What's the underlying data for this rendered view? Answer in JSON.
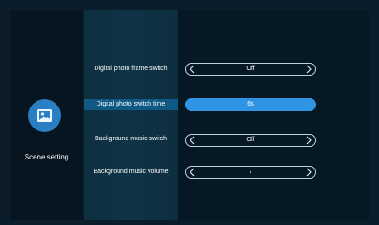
{
  "sidebar": {
    "item_label": "Scene setting",
    "icon": "picture-icon",
    "accent": "#2a7fc4"
  },
  "settings": [
    {
      "label": "Digital photo frame switch",
      "value": "Off",
      "active": false
    },
    {
      "label": "Digital photo switch time",
      "value": "6s",
      "active": true
    },
    {
      "label": "Background music switch",
      "value": "Off",
      "active": false
    },
    {
      "label": "Background music volume",
      "value": "7",
      "active": false
    }
  ],
  "colors": {
    "selected_row": "#0f5985",
    "selected_value": "#2f94e3"
  }
}
